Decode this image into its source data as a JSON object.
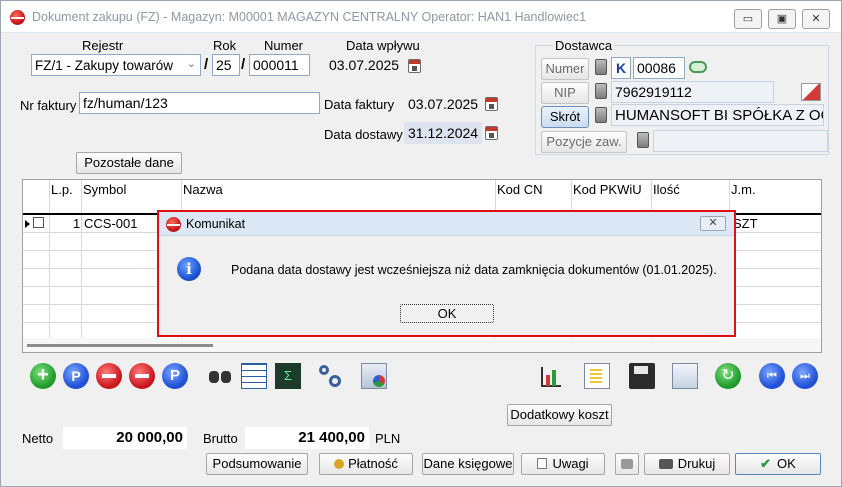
{
  "window": {
    "title": "Dokument zakupu (FZ) - Magazyn: M00001 MAGAZYN CENTRALNY  Operator: HAN1 Handlowiec1",
    "controls": [
      "▭",
      "▣",
      "✕"
    ]
  },
  "header": {
    "rejestr_label": "Rejestr",
    "rok_label": "Rok",
    "numer_label": "Numer",
    "data_wplywu_label": "Data wpływu",
    "rejestr_value": "FZ/1   - Zakupy towarów",
    "slash": "/",
    "rok_value": "25",
    "numer_value": "000011",
    "data_wplywu_value": "03.07.2025",
    "nr_faktury_label": "Nr faktury",
    "nr_faktury_value": "fz/human/123",
    "data_faktury_label": "Data faktury",
    "data_faktury_value": "03.07.2025",
    "data_dostawy_label": "Data dostawy",
    "data_dostawy_value": "31.12.2024",
    "pozostale_button": "Pozostałe dane"
  },
  "dostawca": {
    "group_label": "Dostawca",
    "numer_button": "Numer",
    "k_badge": "K",
    "numer_value": "00086",
    "nip_button": "NIP",
    "nip_value": "7962919112",
    "skrot_button": "Skrót",
    "skrot_value": "HUMANSOFT BI SPÓŁKA Z OG",
    "pozycje_button": "Pozycje zaw.",
    "pozycje_value": ""
  },
  "grid": {
    "columns": [
      "L.p.",
      "Symbol",
      "Nazwa",
      "Kod CN",
      "Kod PKWiU",
      "Ilość",
      "J.m."
    ],
    "row": {
      "lp": "1",
      "symbol": "CCS-001",
      "jm": "SZT"
    }
  },
  "dialog": {
    "title": "Komunikat",
    "message": "Podana data dostawy jest wcześniejsza niż data zamknięcia dokumentów (01.01.2025).",
    "ok_label": "OK",
    "close_label": "✕"
  },
  "footer": {
    "dodatkowy_button": "Dodatkowy koszt",
    "netto_label": "Netto",
    "netto_value": "20 000,00",
    "brutto_label": "Brutto",
    "brutto_value": "21 400,00",
    "currency": "PLN",
    "podsumowanie_button": "Podsumowanie",
    "platnosc_button": "Płatność",
    "dane_ksiegowe_button": "Dane księgowe",
    "uwagi_button": "Uwagi",
    "drukuj_button": "Drukuj",
    "ok_button": "OK"
  },
  "colors": {
    "dialog_border": "#e01010",
    "accent_blue": "#1f56d6",
    "date_highlight": "#dde3ef"
  }
}
